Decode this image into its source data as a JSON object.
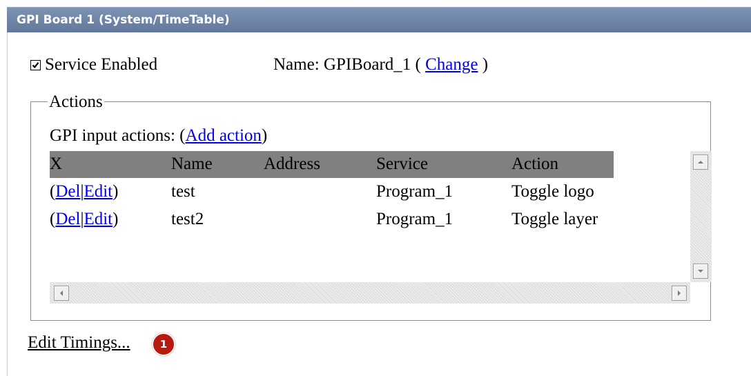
{
  "panel": {
    "title": "GPI Board 1 (System/TimeTable)"
  },
  "service": {
    "enabled": true,
    "enabled_label": "Service Enabled",
    "name_prefix": "Name: GPIBoard_1 (",
    "change_link": "Change",
    "name_suffix": ")"
  },
  "actions": {
    "legend": "Actions",
    "gpi_label_prefix": "GPI input actions: (",
    "add_action_link": "Add action",
    "gpi_label_suffix": ")",
    "columns": [
      "X",
      "Name",
      "Address",
      "Service",
      "Action"
    ],
    "rows": [
      {
        "del": "Del",
        "sep": "|",
        "edit": "Edit",
        "name": "test",
        "address": "",
        "service": "Program_1",
        "action": "Toggle logo"
      },
      {
        "del": "Del",
        "sep": "|",
        "edit": "Edit",
        "name": "test2",
        "address": "",
        "service": "Program_1",
        "action": "Toggle layer"
      }
    ],
    "paren_open": "(",
    "paren_close": ")"
  },
  "footer": {
    "edit_timings_link": "Edit Timings...",
    "badge_count": "1"
  },
  "icons": {
    "checkbox_check": "check-icon",
    "scroll_up": "arrow-up-icon",
    "scroll_down": "arrow-down-icon",
    "scroll_left": "arrow-left-icon",
    "scroll_right": "arrow-right-icon"
  },
  "colors": {
    "title_bar": "#6f86a8",
    "table_header": "#808080",
    "link": "#0000ee",
    "badge": "#b81a12"
  }
}
